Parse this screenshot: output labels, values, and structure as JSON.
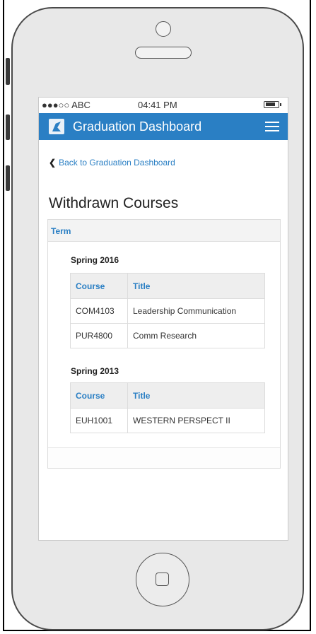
{
  "status_bar": {
    "carrier": "●●●○○ ABC",
    "time": "04:41 PM"
  },
  "navbar": {
    "title": "Graduation Dashboard"
  },
  "back_link": {
    "label": "Back to Graduation Dashboard"
  },
  "page": {
    "title": "Withdrawn Courses"
  },
  "panel": {
    "header": "Term"
  },
  "terms": [
    {
      "label": "Spring 2016",
      "columns": [
        "Course",
        "Title"
      ],
      "rows": [
        [
          "COM4103",
          "Leadership Communication"
        ],
        [
          "PUR4800",
          "Comm Research"
        ]
      ]
    },
    {
      "label": "Spring 2013",
      "columns": [
        "Course",
        "Title"
      ],
      "rows": [
        [
          "EUH1001",
          "WESTERN PERSPECT II"
        ]
      ]
    }
  ],
  "colors": {
    "brand": "#2a7fc4"
  }
}
